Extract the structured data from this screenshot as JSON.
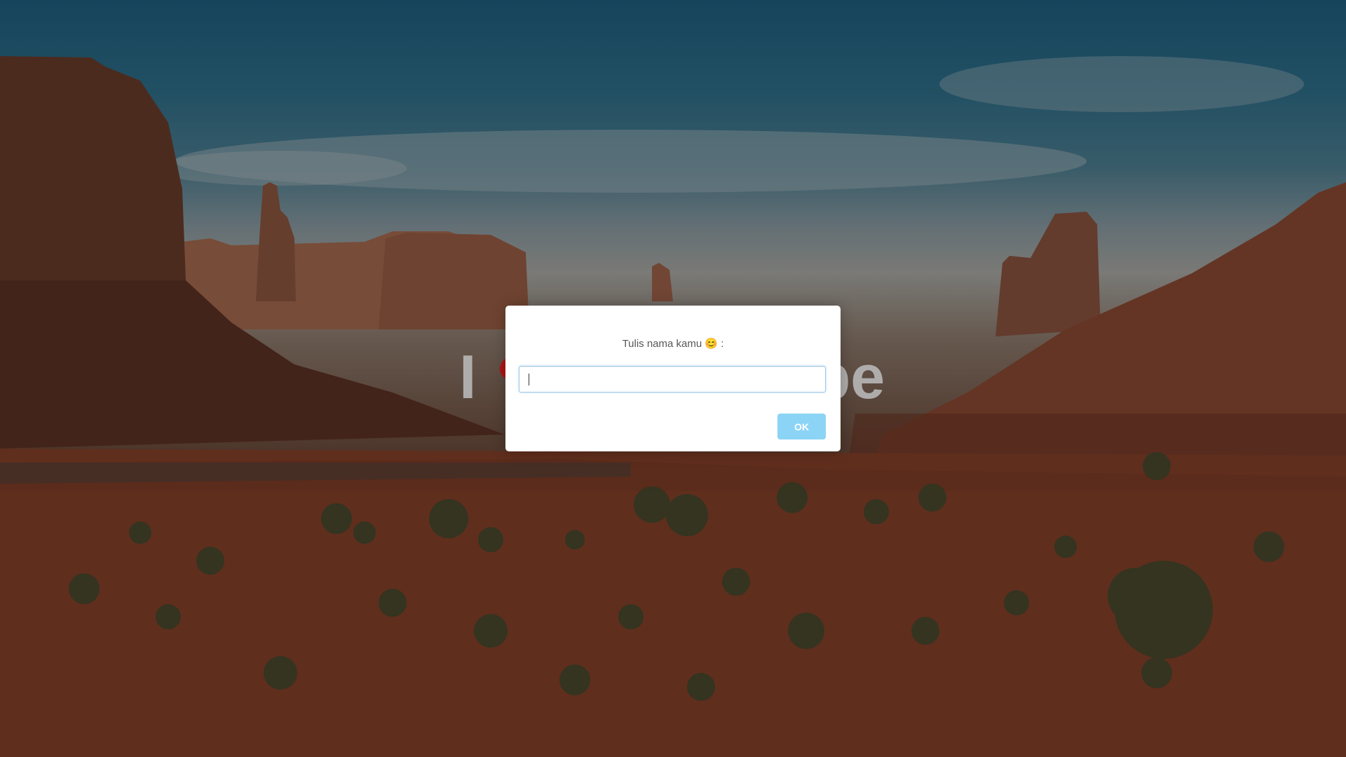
{
  "background": {
    "description_icon": "desert-landscape-image"
  },
  "behind_title": {
    "left_text": "I",
    "heart_glyph": "❤",
    "right_text": "pe"
  },
  "dialog": {
    "prompt_label": "Tulis nama kamu",
    "prompt_emoji": "😊",
    "prompt_suffix": ":",
    "input_value": "",
    "input_placeholder": "",
    "ok_label": "OK"
  },
  "colors": {
    "ok_button": "#8cd4f5",
    "heart": "#b50f12",
    "input_border": "#9dc6e8"
  }
}
